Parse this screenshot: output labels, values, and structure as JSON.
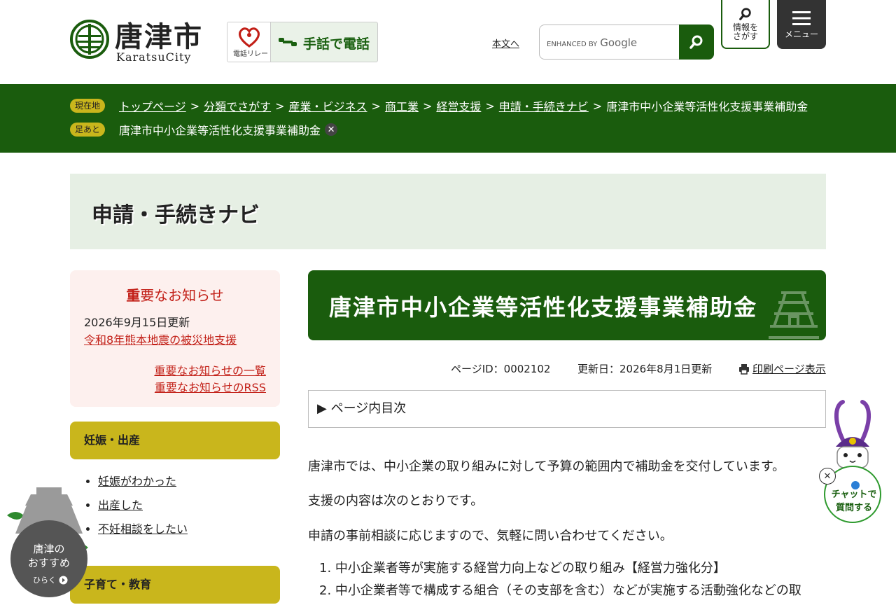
{
  "header": {
    "logo_title": "唐津市",
    "logo_sub": "KaratsuCity",
    "sign_banner_left": "電話リレー",
    "sign_banner_text": "手話で電話",
    "skip_link": "本文へ",
    "search_brand": "ENHANCED BY",
    "search_brand_name": "Google",
    "info_button": [
      "情報を",
      "さがす"
    ],
    "menu_button": "メニュー"
  },
  "breadcrumb": {
    "current_badge": "現在地",
    "items": [
      "トップページ",
      "分類でさがす",
      "産業・ビジネス",
      "商工業",
      "経営支援",
      "申請・手続きナビ"
    ],
    "current": "唐津市中小企業等活性化支援事業補助金",
    "history_badge": "足あと",
    "history_item": "唐津市中小企業等活性化支援事業補助金",
    "close_symbol": "✕"
  },
  "category_title": "申請・手続きナビ",
  "notice": {
    "title_first": "重",
    "title_rest": "要なお知らせ",
    "date": "2026年9月15日更新",
    "link": "令和8年熊本地震の被災地支援",
    "list_link": "重要なお知らせの一覧",
    "rss_link": "重要なお知らせのRSS"
  },
  "sidebar": {
    "categories": [
      "妊娠・出産",
      "子育て・教育"
    ],
    "items": [
      "妊娠がわかった",
      "出産した",
      "不妊相談をしたい"
    ]
  },
  "main": {
    "title": "唐津市中小企業等活性化支援事業補助金",
    "page_id": "ページID：0002102",
    "updated": "更新日：2026年8月1日更新",
    "print": "印刷ページ表示",
    "toc": "▶ ページ内目次",
    "paragraphs": [
      "唐津市では、中小企業の取り組みに対して予算の範囲内で補助金を交付しています。",
      "支援の内容は次のとおりです。",
      "申請の事前相談に応じますので、気軽に問い合わせてください。"
    ],
    "list": [
      "1. 中小企業者等が実施する経営力向上などの取り組み【経営力強化分】",
      "2. 中小企業者等で構成する組合（その支部を含む）などが実施する活動強化などの取"
    ]
  },
  "chat_widget": {
    "close_symbol": "✕",
    "label_line1": "チャットで",
    "label_line2": "質問する"
  },
  "recommend_widget": {
    "line1": "唐津の",
    "line2": "おすすめ",
    "open": "ひらく"
  },
  "colors": {
    "brand_green": "#1a5c0d",
    "accent_yellow": "#c9b61c",
    "notice_red": "#c21f17"
  }
}
